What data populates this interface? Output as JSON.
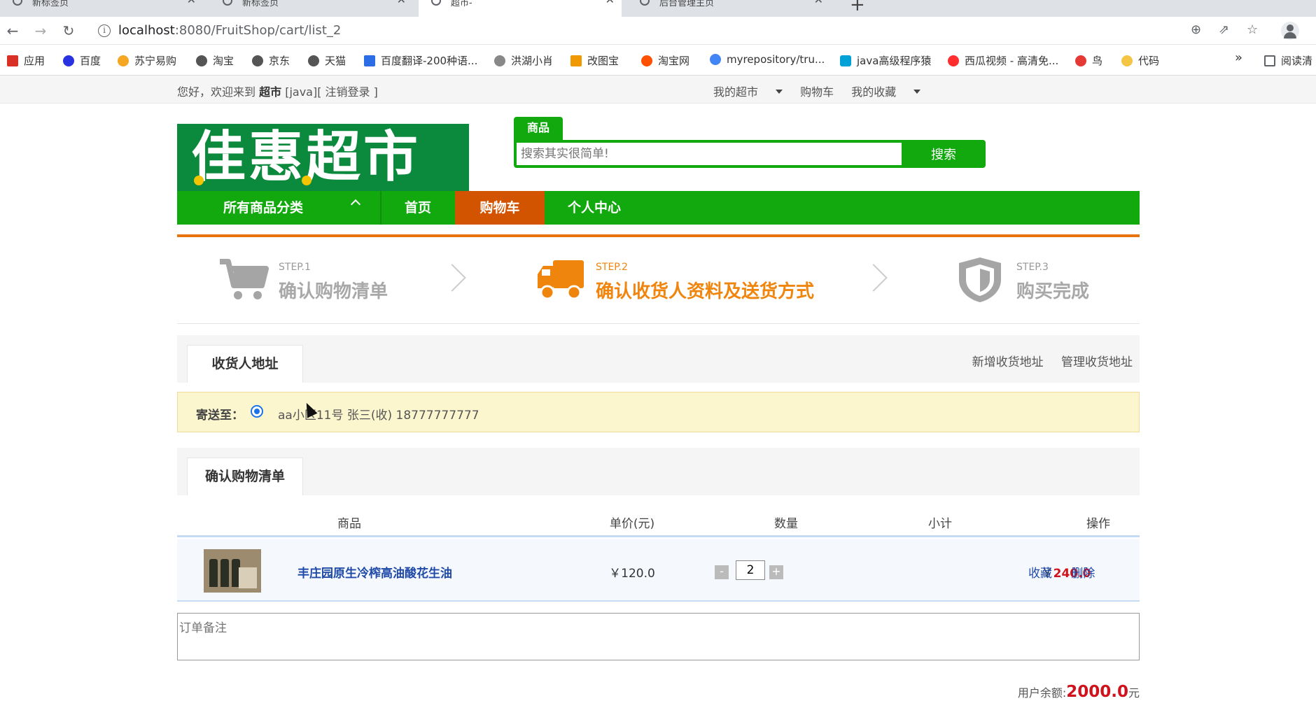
{
  "browser": {
    "tabs": [
      {
        "title": "新标签页"
      },
      {
        "title": "新标签页"
      },
      {
        "title": "超市-"
      },
      {
        "title": "后台管理主页"
      }
    ],
    "url_host": "localhost",
    "url_rest": ":8080/FruitShop/cart/list_2",
    "bookmarks": [
      {
        "label": "应用",
        "color": "#d93025"
      },
      {
        "label": "百度",
        "color": "#2932e1"
      },
      {
        "label": "苏宁易购",
        "color": "#f5a623"
      },
      {
        "label": "淘宝",
        "color": "#555555"
      },
      {
        "label": "京东",
        "color": "#555555"
      },
      {
        "label": "天猫",
        "color": "#555555"
      },
      {
        "label": "百度翻译-200种语...",
        "color": "#2b6de5"
      },
      {
        "label": "洪湖小肖",
        "color": "#888888"
      },
      {
        "label": "改图宝",
        "color": "#f09800"
      },
      {
        "label": "淘宝网",
        "color": "#ff5000"
      },
      {
        "label": "myrepository/tru...",
        "color": "#4285f4"
      },
      {
        "label": "java高级程序猿",
        "color": "#00a1d6"
      },
      {
        "label": "西瓜视频 - 高清免...",
        "color": "#ff2d2d"
      },
      {
        "label": "鸟",
        "color": "#e53935"
      },
      {
        "label": "代码",
        "color": "#f4c542"
      }
    ],
    "overflow": "»",
    "reading_list": "阅读清"
  },
  "topbar": {
    "greeting_prefix": "您好，欢迎来到",
    "shop_name": "超市",
    "user_part": " [java][ 注销登录 ]",
    "links": [
      "我的超市",
      "购物车",
      "我的收藏"
    ]
  },
  "logo": {
    "text": "佳惠超市"
  },
  "search": {
    "tab_label": "商品",
    "placeholder": "搜索其实很简单!",
    "button_label": "搜索"
  },
  "nav": {
    "category_label": "所有商品分类",
    "items": [
      "首页",
      "购物车",
      "个人中心"
    ],
    "active_index": 1
  },
  "steps": [
    {
      "num": "STEP.1",
      "title": "确认购物清单",
      "icon": "cart-icon"
    },
    {
      "num": "STEP.2",
      "title": "确认收货人资料及送货方式",
      "icon": "truck-icon"
    },
    {
      "num": "STEP.3",
      "title": "购买完成",
      "icon": "shield-icon"
    }
  ],
  "active_step": 2,
  "address": {
    "tab_label": "收货人地址",
    "add_link": "新增收货地址",
    "manage_link": "管理收货地址",
    "ship_label": "寄送至：",
    "text": "aa小区11号  张三(收)  18777777777"
  },
  "cart": {
    "tab_label": "确认购物清单",
    "columns": [
      "商品",
      "单价(元)",
      "数量",
      "小计",
      "操作"
    ],
    "items": [
      {
        "name": "丰庄园原生冷榨高油酸花生油",
        "price": "￥120.0",
        "qty": "2",
        "subtotal_prefix": "￥",
        "subtotal": "240.0",
        "actions": [
          "收藏",
          "删除"
        ]
      }
    ]
  },
  "remark": {
    "placeholder": "订单备注"
  },
  "balance": {
    "label": "用户余额:",
    "value": "2000.0",
    "unit": "元"
  },
  "colors": {
    "brand_green": "#12a90f",
    "accent_orange": "#d35400",
    "price_red": "#d0121c"
  }
}
